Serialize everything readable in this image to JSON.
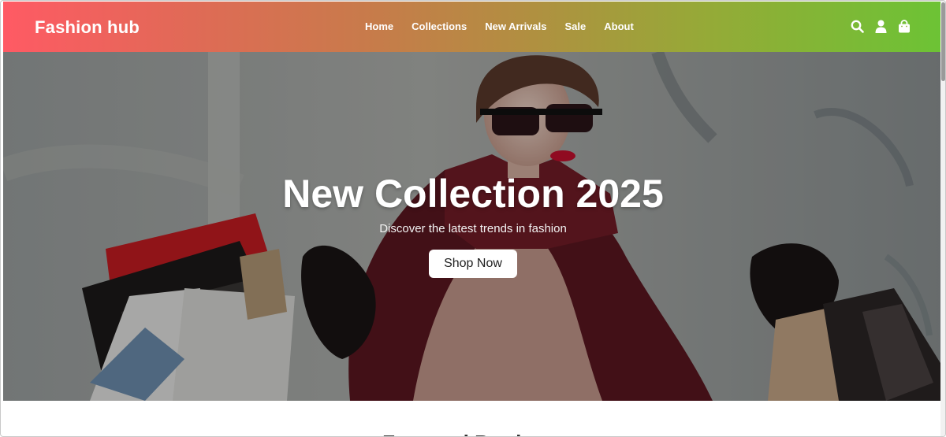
{
  "brand": {
    "name": "Fashion hub"
  },
  "nav": {
    "links": [
      "Home",
      "Collections",
      "New Arrivals",
      "Sale",
      "About"
    ],
    "icons": [
      "search-icon",
      "user-icon",
      "shopping-bag-icon"
    ]
  },
  "hero": {
    "title": "New Collection 2025",
    "subtitle": "Discover the latest trends in fashion",
    "cta": "Shop Now"
  },
  "section": {
    "heading": "Featured Products"
  },
  "colors": {
    "nav_gradient_start": "#ff5a64",
    "nav_gradient_end": "#6cc335",
    "hero_text": "#ffffff",
    "button_bg": "#ffffff"
  }
}
